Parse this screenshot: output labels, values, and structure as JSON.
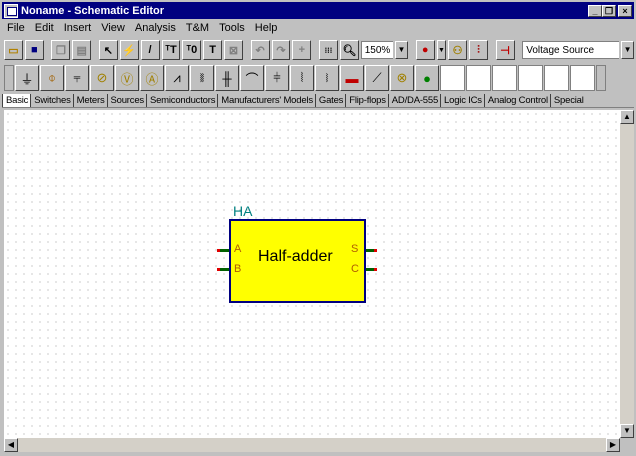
{
  "window": {
    "title": "Noname - Schematic Editor"
  },
  "menu": [
    "File",
    "Edit",
    "Insert",
    "View",
    "Analysis",
    "T&M",
    "Tools",
    "Help"
  ],
  "toolbar": {
    "zoom": "150%",
    "component_select": "Voltage Source"
  },
  "tabs": [
    "Basic",
    "Switches",
    "Meters",
    "Sources",
    "Semiconductors",
    "Manufacturers' Models",
    "Gates",
    "Flip-flops",
    "AD/DA-555",
    "Logic ICs",
    "Analog Control",
    "Special"
  ],
  "component": {
    "label": "HA",
    "name": "Half-adder",
    "input_pins": [
      "A",
      "B"
    ],
    "output_pins": [
      "S",
      "C"
    ]
  },
  "colors": {
    "title_bar": "#000080",
    "component_fill": "#ffff00",
    "component_border": "#000080",
    "label": "#008080"
  }
}
